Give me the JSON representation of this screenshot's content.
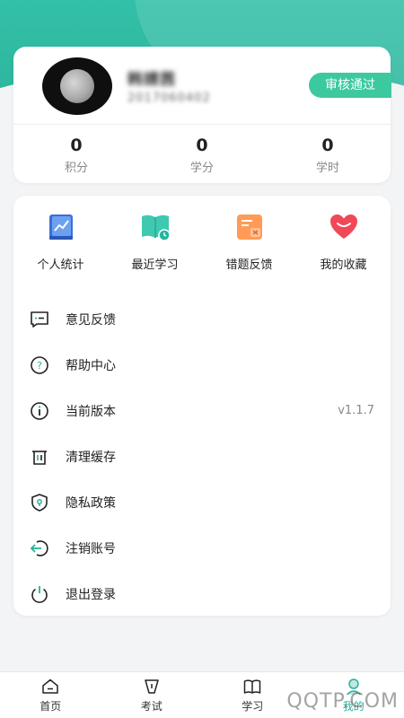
{
  "profile": {
    "name": "韩婧茜",
    "id": "2017060402",
    "status_badge": "审核通过"
  },
  "stats": [
    {
      "value": "0",
      "label": "积分"
    },
    {
      "value": "0",
      "label": "学分"
    },
    {
      "value": "0",
      "label": "学时"
    }
  ],
  "quick_actions": [
    {
      "label": "个人统计",
      "icon": "chart-book-icon"
    },
    {
      "label": "最近学习",
      "icon": "recent-study-icon"
    },
    {
      "label": "错题反馈",
      "icon": "wrong-question-icon"
    },
    {
      "label": "我的收藏",
      "icon": "heart-icon"
    }
  ],
  "menu": [
    {
      "label": "意见反馈",
      "icon": "feedback-icon",
      "value": ""
    },
    {
      "label": "帮助中心",
      "icon": "help-icon",
      "value": ""
    },
    {
      "label": "当前版本",
      "icon": "info-icon",
      "value": "v1.1.7"
    },
    {
      "label": "清理缓存",
      "icon": "trash-icon",
      "value": ""
    },
    {
      "label": "隐私政策",
      "icon": "shield-icon",
      "value": ""
    },
    {
      "label": "注销账号",
      "icon": "logout-arrow-icon",
      "value": ""
    },
    {
      "label": "退出登录",
      "icon": "power-icon",
      "value": ""
    }
  ],
  "tabs": [
    {
      "label": "首页",
      "icon": "home-icon"
    },
    {
      "label": "考试",
      "icon": "exam-icon"
    },
    {
      "label": "学习",
      "icon": "book-icon"
    },
    {
      "label": "我的",
      "icon": "user-icon",
      "active": true
    }
  ],
  "watermark": "QQTP.COM",
  "colors": {
    "accent": "#2ab19a",
    "badge": "#3cc9a0"
  }
}
